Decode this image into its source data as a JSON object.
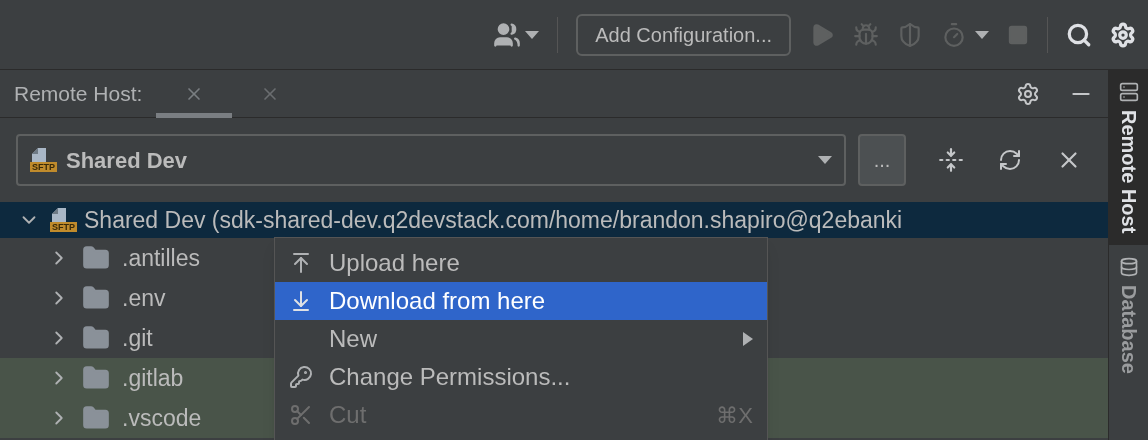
{
  "toolbar": {
    "config_button": "Add Configuration..."
  },
  "panel": {
    "title": "Remote Host:",
    "tabs": [
      {
        "selected": true
      },
      {
        "selected": false
      }
    ]
  },
  "host_select": {
    "badge": "SFTP",
    "value": "Shared Dev",
    "more_button": "..."
  },
  "tree": {
    "root": {
      "label": "Shared Dev (sdk-shared-dev.q2devstack.com/home/brandon.shapiro@q2ebanki",
      "badge": "SFTP",
      "expanded": true,
      "selected": true,
      "children": [
        {
          "label": ".antilles",
          "expanded": false,
          "highlighted": false
        },
        {
          "label": ".env",
          "expanded": false,
          "highlighted": false
        },
        {
          "label": ".git",
          "expanded": false,
          "highlighted": false
        },
        {
          "label": ".gitlab",
          "expanded": false,
          "highlighted": true
        },
        {
          "label": ".vscode",
          "expanded": false,
          "highlighted": true
        }
      ]
    }
  },
  "context_menu": [
    {
      "kind": "upload",
      "label": "Upload here",
      "selected": false,
      "disabled": false
    },
    {
      "kind": "download",
      "label": "Download from here",
      "selected": true,
      "disabled": false
    },
    {
      "kind": "submenu",
      "label": "New",
      "selected": false,
      "disabled": false
    },
    {
      "kind": "key",
      "label": "Change Permissions...",
      "selected": false,
      "disabled": false
    },
    {
      "kind": "cut",
      "label": "Cut",
      "shortcut": "⌘X",
      "selected": false,
      "disabled": true
    }
  ],
  "side_tabs": [
    {
      "kind": "server",
      "label": "Remote Host",
      "selected": true
    },
    {
      "kind": "database",
      "label": "Database",
      "selected": false
    }
  ]
}
